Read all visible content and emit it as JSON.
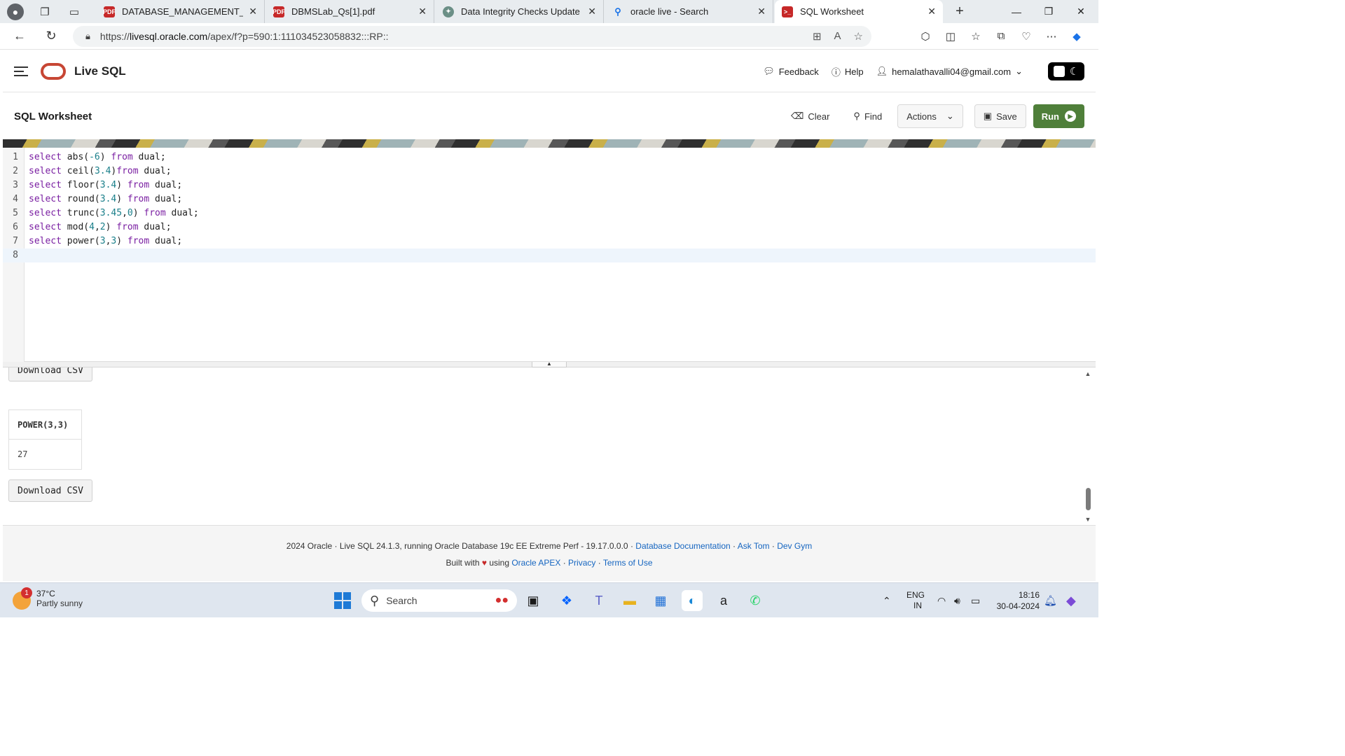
{
  "browser": {
    "tabs": [
      {
        "title": "DATABASE_MANAGEMENT_SYST",
        "icon": "pdf-icon",
        "color": "#c62828"
      },
      {
        "title": "DBMSLab_Qs[1].pdf",
        "icon": "pdf-icon",
        "color": "#c62828"
      },
      {
        "title": "Data Integrity Checks Update",
        "icon": "chatgpt-icon",
        "color": "#6b8f86"
      },
      {
        "title": "oracle live - Search",
        "icon": "bing-search-icon",
        "color": "#1a73e8"
      },
      {
        "title": "SQL Worksheet",
        "icon": "oracle-sql-icon",
        "color": "#c62828"
      }
    ],
    "url_prefix": "https://",
    "url_host": "livesql.oracle.com",
    "url_path": "/apex/f?p=590:1:111034523058832:::RP::"
  },
  "app": {
    "title": "Live SQL",
    "feedback": "Feedback",
    "help": "Help",
    "user_email": "hemalathavalli04@gmail.com"
  },
  "worksheet": {
    "title": "SQL Worksheet",
    "clear": "Clear",
    "find": "Find",
    "actions": "Actions",
    "save": "Save",
    "run": "Run"
  },
  "editor": {
    "lines": [
      {
        "n": "1",
        "text": "select abs(-6) from dual;"
      },
      {
        "n": "2",
        "text": "select ceil(3.4)from dual;"
      },
      {
        "n": "3",
        "text": "select floor(3.4) from dual;"
      },
      {
        "n": "4",
        "text": "select round(3.4) from dual;"
      },
      {
        "n": "5",
        "text": "select trunc(3.45,0) from dual;"
      },
      {
        "n": "6",
        "text": "select mod(4,2) from dual;"
      },
      {
        "n": "7",
        "text": "select power(3,3) from dual;"
      },
      {
        "n": "8",
        "text": ""
      }
    ]
  },
  "results": {
    "download_csv": "Download CSV",
    "column_header": "POWER(3,3)",
    "cell_value": "27"
  },
  "footer": {
    "line1_text": "2024 Oracle · Live SQL 24.1.3, running Oracle Database 19c EE Extreme Perf - 19.17.0.0.0 · ",
    "doc_link": "Database Documentation",
    "ask_tom": "Ask Tom",
    "dev_gym": "Dev Gym",
    "built_with": "Built with",
    "using": "using",
    "apex_link": "Oracle APEX",
    "privacy": "Privacy",
    "terms": "Terms of Use"
  },
  "taskbar": {
    "weather_badge": "1",
    "temperature": "37°C",
    "condition": "Partly sunny",
    "search_label": "Search",
    "lang": "ENG",
    "region": "IN",
    "time": "18:16",
    "date": "30-04-2024"
  }
}
